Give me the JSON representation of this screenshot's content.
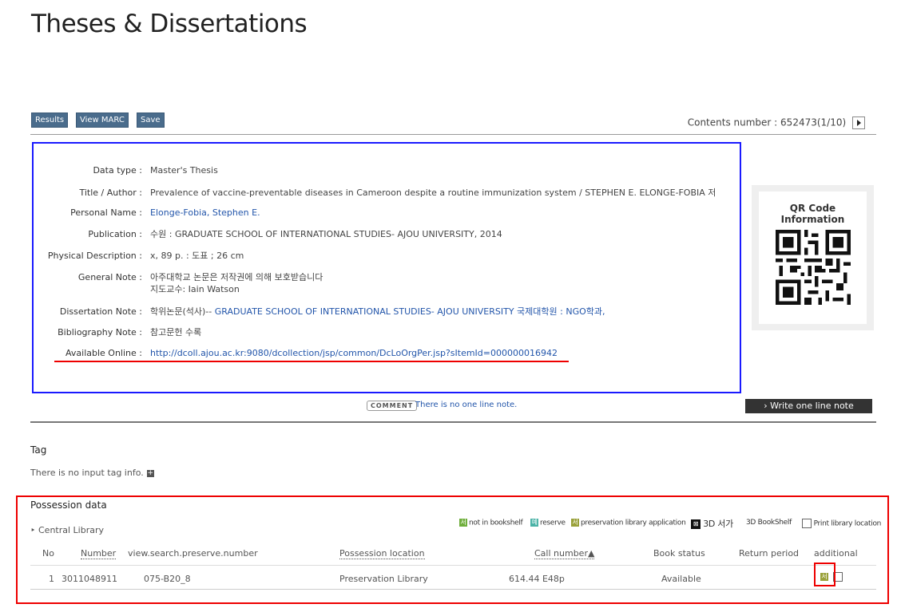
{
  "page": {
    "title": "Theses & Dissertations"
  },
  "toolbar": {
    "results": "Results",
    "view_marc": "View MARC",
    "save": "Save"
  },
  "contents": {
    "label": "Contents number :",
    "value": "652473(1/10)"
  },
  "details": [
    {
      "label": "Data type :",
      "value": "Master's Thesis"
    },
    {
      "label": "Title / Author :",
      "value": "Prevalence of vaccine-preventable diseases in Cameroon despite a routine immunization system / STEPHEN E. ELONGE-FOBIA 저"
    },
    {
      "label": "Personal Name :",
      "value": "Elonge-Fobia, Stephen E."
    },
    {
      "label": "Publication :",
      "value": "수원 : GRADUATE SCHOOL OF INTERNATIONAL STUDIES- AJOU UNIVERSITY, 2014"
    },
    {
      "label": "Physical Description :",
      "value": "x, 89 p. : 도표 ; 26 cm"
    },
    {
      "label": "General Note :",
      "value": "아주대학교 논문은 저작권에 의해 보호받습니다",
      "value2": "지도교수: Iain Watson"
    },
    {
      "label": "Dissertation Note :",
      "value_prefix": "학위논문(석사)-- ",
      "value": "GRADUATE SCHOOL OF INTERNATIONAL STUDIES- AJOU UNIVERSITY 국제대학원 : NGO학과,"
    },
    {
      "label": "Bibliography Note :",
      "value": "참고문헌 수록"
    },
    {
      "label": "Available Online :",
      "value": "http://dcoll.ajou.ac.kr:9080/dcollection/jsp/common/DcLoOrgPer.jsp?sItemId=000000016942"
    }
  ],
  "qr": {
    "title": "QR Code Information"
  },
  "comment": {
    "badge": "COMMENT",
    "text": "There is no one line note.",
    "write_button": "Write one line note contents"
  },
  "tag": {
    "heading": "Tag",
    "info": "There is no input tag info."
  },
  "possession": {
    "heading": "Possession data",
    "library": "Central Library",
    "legend": {
      "not_in_bookshelf": "not in bookshelf",
      "reserve": "reserve",
      "preservation_app": "preservation library application",
      "icon_3d": "3D 서가",
      "bookshelf_3d": "3D BookShelf",
      "print_location": "Print library location"
    },
    "columns": [
      "No",
      "Number",
      "view.search.preserve.number",
      "Possession location",
      "Call number▲",
      "Book status",
      "Return period",
      "additional"
    ],
    "rows": [
      {
        "no": "1",
        "number": "3011048911",
        "preserve": "075-B20_8",
        "location": "Preservation Library",
        "call": "614.44 E48p",
        "status": "Available",
        "return": ""
      }
    ]
  },
  "icons": {
    "not_in_bookshelf": "서",
    "reserve": "예",
    "preservation": "서",
    "box_3d": "⊠"
  }
}
